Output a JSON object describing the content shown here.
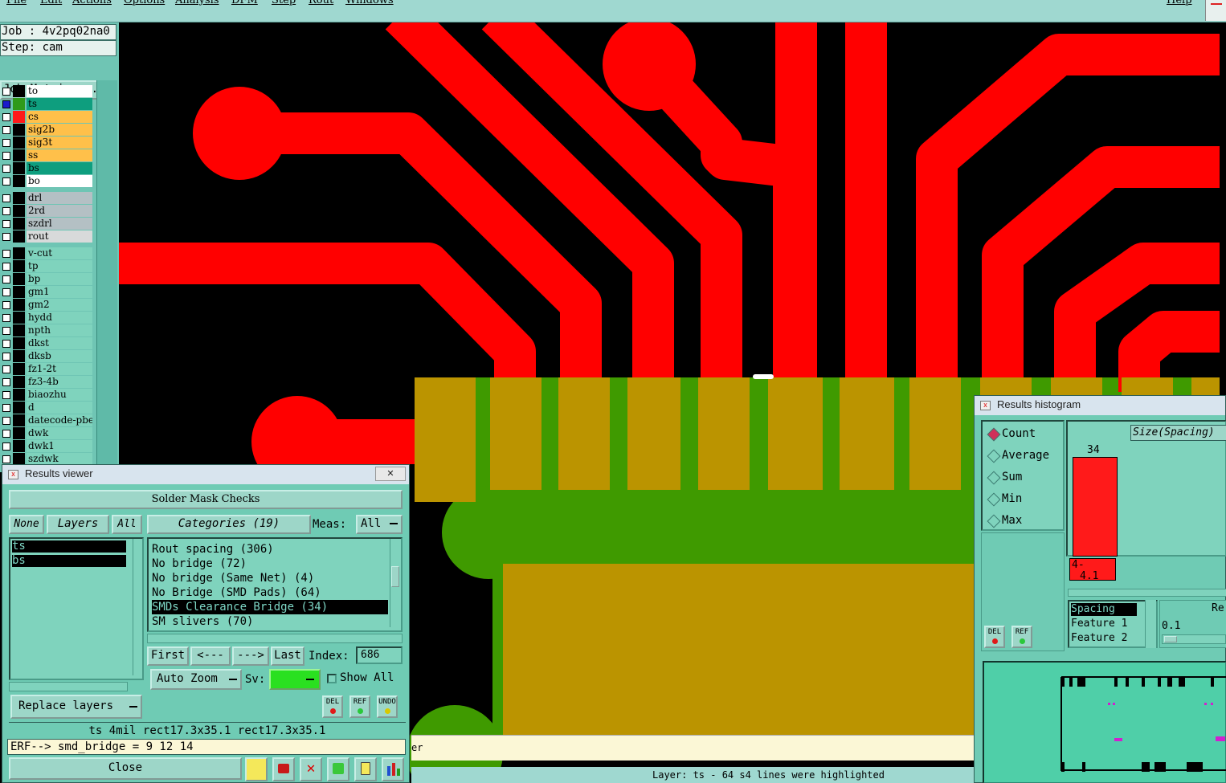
{
  "menubar": {
    "items": [
      "File",
      "Edit",
      "Actions",
      "Options",
      "Analysis",
      "DFM",
      "Step",
      "Rout",
      "Windows"
    ],
    "help": "Help"
  },
  "job": {
    "job_line": "Job : 4v2pq02na0",
    "step_line": "Step: cam",
    "matrix_button": "Job Matrix ..."
  },
  "layers_group1": [
    {
      "name": "to",
      "bg": "#ffffff",
      "swatch": "#000000"
    },
    {
      "name": "ts",
      "bg": "#0e9e7e",
      "swatch": "#2f9a1a"
    },
    {
      "name": "cs",
      "bg": "#ffc04a",
      "swatch": "#ff1a1a"
    },
    {
      "name": "sig2b",
      "bg": "#ffc04a",
      "swatch": "#000000"
    },
    {
      "name": "sig3t",
      "bg": "#ffc04a",
      "swatch": "#000000"
    },
    {
      "name": "ss",
      "bg": "#ffc04a",
      "swatch": "#000000"
    },
    {
      "name": "bs",
      "bg": "#0e9e7e",
      "swatch": "#000000"
    },
    {
      "name": "bo",
      "bg": "#ffffff",
      "swatch": "#000000"
    }
  ],
  "layers_group2": [
    {
      "name": "drl",
      "bg": "#b4c0c4",
      "swatch": "#000000"
    },
    {
      "name": "2rd",
      "bg": "#b4c0c4",
      "swatch": "#000000"
    },
    {
      "name": "szdrl",
      "bg": "#b4c0c4",
      "swatch": "#000000"
    },
    {
      "name": "rout",
      "bg": "#d8dada",
      "swatch": "#000000"
    }
  ],
  "layers_group3": [
    {
      "name": "v-cut"
    },
    {
      "name": "tp"
    },
    {
      "name": "bp"
    },
    {
      "name": "gm1"
    },
    {
      "name": "gm2"
    },
    {
      "name": "hydd"
    },
    {
      "name": "npth"
    },
    {
      "name": "dkst"
    },
    {
      "name": "dksb"
    },
    {
      "name": "fz1-2t"
    },
    {
      "name": "fz3-4b"
    },
    {
      "name": "biaozhu"
    },
    {
      "name": "d"
    },
    {
      "name": "datecode-pbe"
    },
    {
      "name": "dwk"
    },
    {
      "name": "dwk1"
    },
    {
      "name": "szdwk"
    }
  ],
  "results_viewer": {
    "title": "Results viewer",
    "close_x": "✕",
    "header": "Solder Mask Checks",
    "none_btn": "None",
    "layers_btn": "Layers",
    "all_btn": "All",
    "layers": [
      "ts",
      "bs"
    ],
    "categories_btn": "Categories (19)",
    "meas_label": "Meas:",
    "meas_value": "All",
    "categories": [
      "Rout spacing (306)",
      "No bridge (72)",
      "No bridge (Same Net) (4)",
      "No Bridge (SMD Pads) (64)",
      "SMDs Clearance Bridge (34)",
      "SM slivers (70)"
    ],
    "selected_category": 4,
    "first_btn": "First",
    "prev_btn": "<---",
    "next_btn": "--->",
    "last_btn": "Last",
    "index_label": "Index:",
    "index_value": "686",
    "autozoom_btn": "Auto Zoom",
    "sv_label": "Sv:",
    "show_all_label": "Show All",
    "del_label": "DEL",
    "ref_label": "REF",
    "undo_label": "UNDO",
    "replace_btn": "Replace layers",
    "info_line": "ts 4mil  rect17.3x35.1  rect17.3x35.1",
    "erf_line": "ERF--> smd_bridge = 9 12 14",
    "close_btn": "Close"
  },
  "histogram": {
    "title": "Results histogram",
    "options": [
      "Count",
      "Average",
      "Sum",
      "Min",
      "Max"
    ],
    "selected_option": 0,
    "size_label": "Size(Spacing)",
    "bar_value": "34",
    "bar_range_1": "4-",
    "bar_range_2": "4.1",
    "attrs": [
      "Spacing",
      "Feature 1",
      "Feature 2"
    ],
    "right_label": "Re",
    "value_label": "0.1",
    "del_label": "DEL",
    "ref_label": "REF"
  },
  "status": {
    "message_tail": "er",
    "bottom_line": "Layer: ts - 64 s4 lines were highlighted"
  },
  "colors": {
    "trace": "#ff0000",
    "mask_green": "#3f9a00",
    "pad_gold": "#bb9400",
    "panel": "#6fcbb4"
  }
}
